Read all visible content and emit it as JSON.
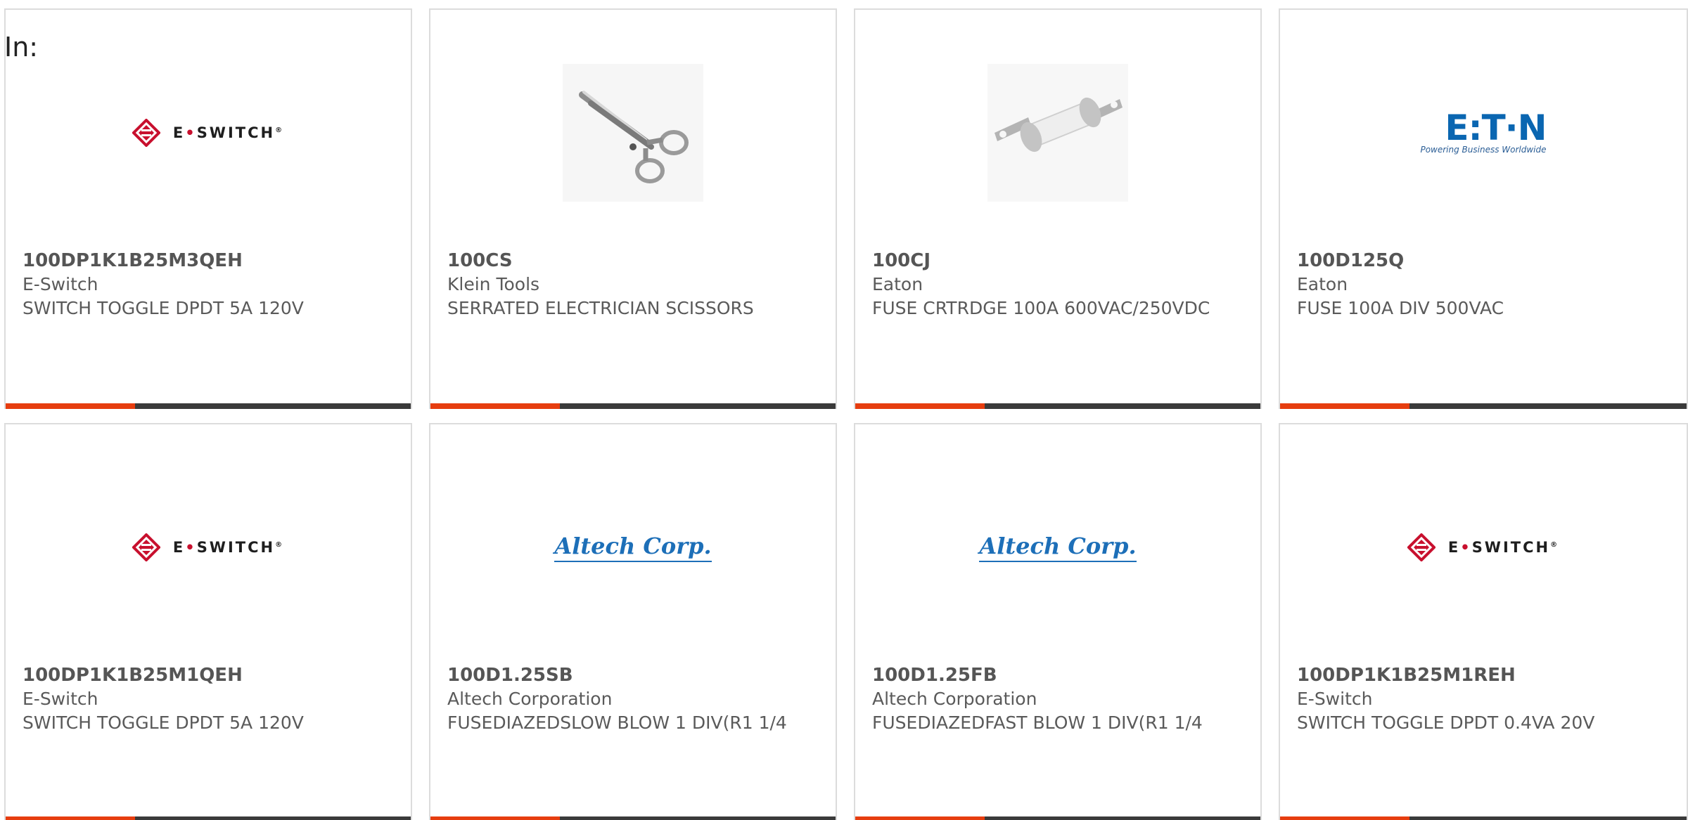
{
  "filter": {
    "label": "In:"
  },
  "brands": {
    "eswitch": {
      "word_left": "E",
      "word_dot": "•",
      "word_right": "SWITCH",
      "mark": "®"
    },
    "altech": {
      "text": "Altech Corp."
    },
    "eaton": {
      "word": "E:T·N",
      "tagline": "Powering Business Worldwide"
    }
  },
  "products": [
    {
      "part_number": "100DP1K1B25M3QEH",
      "manufacturer": "E-Switch",
      "description": "SWITCH TOGGLE DPDT 5A 120V",
      "image": "eswitch-logo"
    },
    {
      "part_number": "100CS",
      "manufacturer": "Klein Tools",
      "description": "SERRATED ELECTRICIAN SCISSORS",
      "image": "scissors-photo"
    },
    {
      "part_number": "100CJ",
      "manufacturer": "Eaton",
      "description": "FUSE CRTRDGE 100A 600VAC/250VDC",
      "image": "fuse-photo"
    },
    {
      "part_number": "100D125Q",
      "manufacturer": "Eaton",
      "description": "FUSE 100A DIV 500VAC",
      "image": "eaton-logo"
    },
    {
      "part_number": "100DP1K1B25M1QEH",
      "manufacturer": "E-Switch",
      "description": "SWITCH TOGGLE DPDT 5A 120V",
      "image": "eswitch-logo"
    },
    {
      "part_number": "100D1.25SB",
      "manufacturer": "Altech Corporation",
      "description": "FUSEDIAZEDSLOW BLOW 1 DIV(R1 1/4",
      "image": "altech-logo"
    },
    {
      "part_number": "100D1.25FB",
      "manufacturer": "Altech Corporation",
      "description": "FUSEDIAZEDFAST BLOW 1 DIV(R1 1/4",
      "image": "altech-logo"
    },
    {
      "part_number": "100DP1K1B25M1REH",
      "manufacturer": "E-Switch",
      "description": "SWITCH TOGGLE DPDT 0.4VA 20V",
      "image": "eswitch-logo"
    }
  ],
  "colors": {
    "accent": "#e63d0f",
    "bar": "#3a3a3a",
    "eswitch_red": "#c8102e",
    "altech_blue": "#1d6fb8",
    "eaton_blue": "#0a66b1"
  }
}
